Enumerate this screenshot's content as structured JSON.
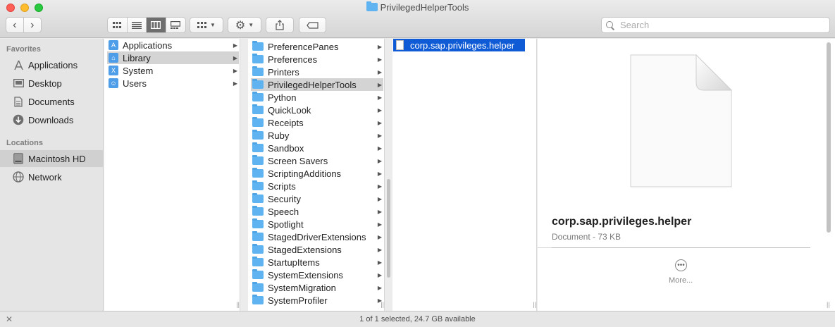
{
  "window": {
    "title": "PrivilegedHelperTools"
  },
  "toolbar": {
    "back_icon": "chevron-left-icon",
    "forward_icon": "chevron-right-icon",
    "view_icons": [
      "icon-view-icon",
      "list-view-icon",
      "column-view-icon",
      "gallery-view-icon"
    ],
    "active_view": "column-view-icon",
    "group_icon": "group-icon",
    "action_icon": "gear-icon",
    "share_icon": "share-icon",
    "tag_icon": "tag-icon"
  },
  "search": {
    "placeholder": "Search"
  },
  "sidebar": {
    "favorites_heading": "Favorites",
    "favorites": [
      {
        "label": "Applications",
        "icon": "applications-icon"
      },
      {
        "label": "Desktop",
        "icon": "desktop-icon"
      },
      {
        "label": "Documents",
        "icon": "documents-icon"
      },
      {
        "label": "Downloads",
        "icon": "downloads-icon"
      }
    ],
    "locations_heading": "Locations",
    "locations": [
      {
        "label": "Macintosh HD",
        "icon": "hard-drive-icon",
        "selected": true
      },
      {
        "label": "Network",
        "icon": "network-icon"
      }
    ]
  },
  "column1": {
    "items": [
      {
        "label": "Applications",
        "icon": "applications-folder-icon"
      },
      {
        "label": "Library",
        "icon": "library-folder-icon",
        "selected": true
      },
      {
        "label": "System",
        "icon": "system-folder-icon"
      },
      {
        "label": "Users",
        "icon": "users-folder-icon"
      }
    ]
  },
  "column2": {
    "items": [
      "PreferencePanes",
      "Preferences",
      "Printers",
      "PrivilegedHelperTools",
      "Python",
      "QuickLook",
      "Receipts",
      "Ruby",
      "Sandbox",
      "Screen Savers",
      "ScriptingAdditions",
      "Scripts",
      "Security",
      "Speech",
      "Spotlight",
      "StagedDriverExtensions",
      "StagedExtensions",
      "StartupItems",
      "SystemExtensions",
      "SystemMigration",
      "SystemProfiler"
    ],
    "selected": "PrivilegedHelperTools"
  },
  "column3": {
    "items": [
      {
        "label": "corp.sap.privileges.helper",
        "icon": "document-icon",
        "selected": true
      }
    ]
  },
  "preview": {
    "name": "corp.sap.privileges.helper",
    "kind": "Document - 73 KB",
    "more_label": "More..."
  },
  "status": {
    "text": "1 of 1 selected, 24.7 GB available"
  }
}
